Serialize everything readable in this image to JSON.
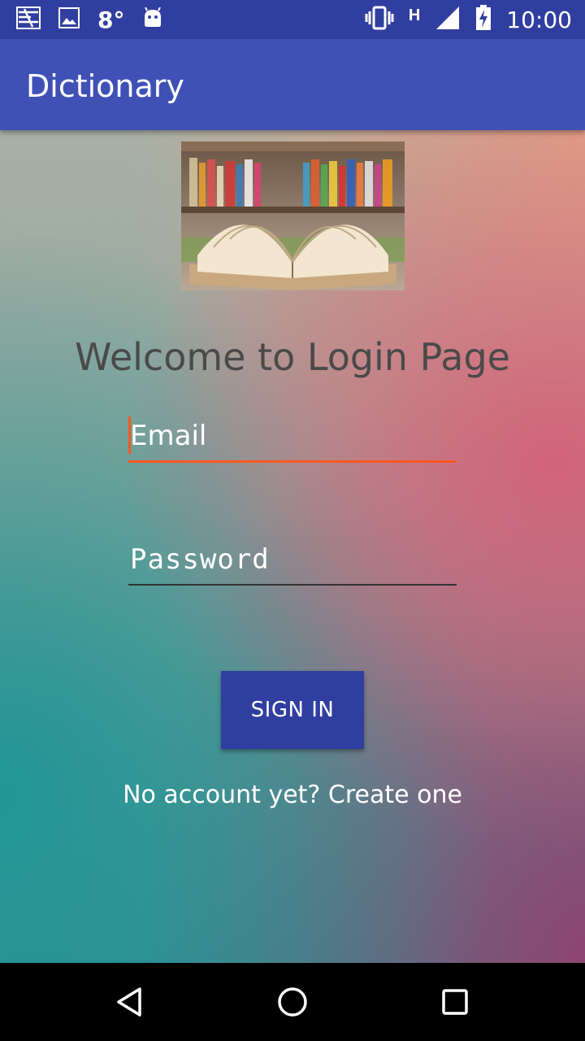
{
  "status_bar": {
    "temperature": "8°",
    "network": "H",
    "time": "10:00",
    "icons": [
      "notification-icon",
      "image-icon",
      "android-icon",
      "vibrate-icon",
      "signal-icon",
      "battery-charging-icon"
    ]
  },
  "app_bar": {
    "title": "Dictionary"
  },
  "login": {
    "welcome": "Welcome to Login Page",
    "email_placeholder": "Email",
    "email_value": "",
    "password_placeholder": "Password",
    "password_value": "",
    "sign_in_label": "SIGN IN",
    "create_account_text": "No account yet? Create one"
  },
  "nav_bar": {
    "buttons": [
      "back-icon",
      "home-icon",
      "recents-icon"
    ]
  },
  "colors": {
    "primary": "#3f51b5",
    "primary_dark": "#303f9f",
    "accent": "#ff5722"
  }
}
